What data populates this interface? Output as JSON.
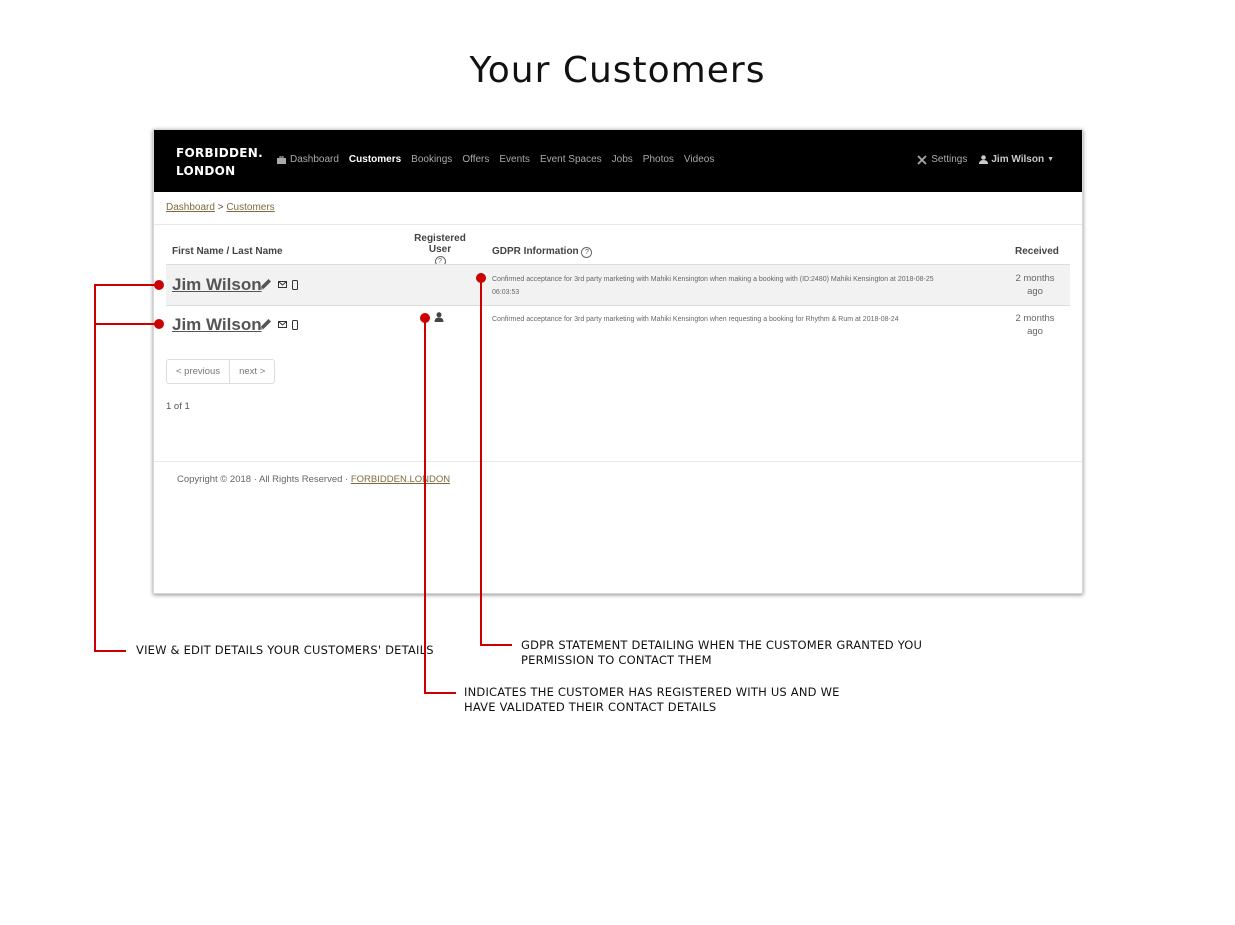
{
  "page_title": "Your Customers",
  "app": {
    "brand_line1": "FORBIDDEN.",
    "brand_line2": "LONDON",
    "nav": [
      "Dashboard",
      "Customers",
      "Bookings",
      "Offers",
      "Events",
      "Event Spaces",
      "Jobs",
      "Photos",
      "Videos"
    ],
    "active_nav": "Customers",
    "settings_label": "Settings",
    "user_label": "Jim Wilson"
  },
  "breadcrumb": {
    "root": "Dashboard",
    "separator": ">",
    "current": "Customers"
  },
  "table": {
    "columns": {
      "name": "First Name / Last Name",
      "registered": "Registered User",
      "gdpr": "GDPR Information",
      "received": "Received"
    },
    "rows": [
      {
        "name": "Jim Wilson",
        "registered": false,
        "gdpr_line1": "Confirmed acceptance for 3rd party marketing with Mahiki Kensington when making a booking with (ID:2480) Mahiki Kensington at 2018-08-25",
        "gdpr_line2": "06:03:53",
        "received_line1": "2 months",
        "received_line2": "ago"
      },
      {
        "name": "Jim Wilson",
        "registered": true,
        "gdpr_line1": "Confirmed acceptance for 3rd party marketing with Mahiki Kensington when requesting a booking for Rhythm & Rum at 2018-08-24",
        "gdpr_line2": "",
        "received_line1": "2 months",
        "received_line2": "ago"
      }
    ]
  },
  "pagination": {
    "previous": "< previous",
    "next": "next >",
    "count": "1 of 1"
  },
  "footer": {
    "text": "Copyright © 2018 · All Rights Reserved · ",
    "link": "FORBIDDEN.LONDON"
  },
  "annotations": {
    "edit_details": "VIEW & EDIT DETAILS YOUR CUSTOMERS' DETAILS",
    "gdpr_line1": "GDPR STATEMENT DETAILING WHEN THE CUSTOMER GRANTED YOU",
    "gdpr_line2": "PERMISSION TO CONTACT THEM",
    "registered_line1": "INDICATES THE CUSTOMER HAS REGISTERED WITH US AND WE",
    "registered_line2": "HAVE VALIDATED THEIR CONTACT DETAILS"
  },
  "colors": {
    "accent_red": "#cc0000",
    "navbar": "#000000",
    "link_gold": "#7d6b3f"
  }
}
